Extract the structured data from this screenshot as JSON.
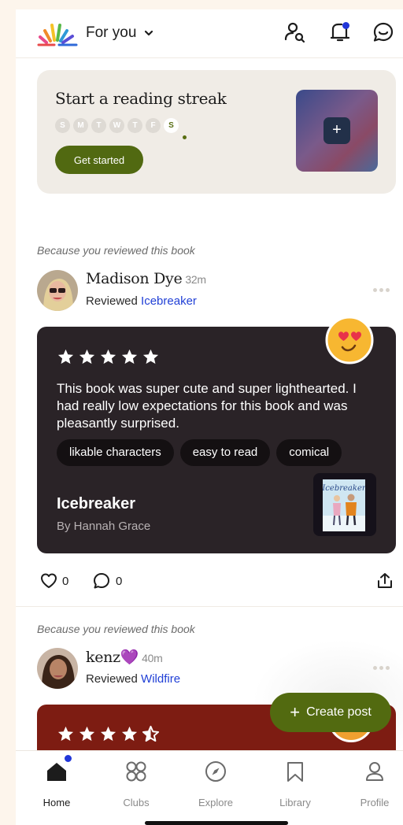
{
  "header": {
    "feed_label": "For you",
    "icons": [
      "rainbow-logo-icon",
      "chevron-down-icon",
      "find-people-icon",
      "notification-icon",
      "messages-icon"
    ]
  },
  "streak": {
    "title": "Start a reading streak",
    "days": [
      "S",
      "M",
      "T",
      "W",
      "T",
      "F",
      "S"
    ],
    "today_index": 6,
    "button": "Get started",
    "add_label": "+"
  },
  "posts": [
    {
      "reason": "Because you reviewed this book",
      "user": "Madison Dye",
      "time": "32m",
      "action": "Reviewed",
      "book": "Icebreaker",
      "rating": 5,
      "review": "This book was super cute and super lighthearted. I had really low expectations for this book and was pleasantly surprised.",
      "tags": [
        "likable characters",
        "easy to read",
        "comical"
      ],
      "book_title": "Icebreaker",
      "book_author": "By Hannah Grace",
      "likes": "0",
      "comments": "0"
    },
    {
      "reason": "Because you reviewed this book",
      "user": "kenz💜",
      "time": "40m",
      "action": "Reviewed",
      "book": "Wildfire",
      "rating": 4.5
    }
  ],
  "fab": {
    "label": "Create post",
    "plus": "+"
  },
  "nav": {
    "items": [
      {
        "label": "Home",
        "icon": "home-icon",
        "active": true
      },
      {
        "label": "Clubs",
        "icon": "clubs-icon"
      },
      {
        "label": "Explore",
        "icon": "compass-icon"
      },
      {
        "label": "Library",
        "icon": "bookmark-icon"
      },
      {
        "label": "Profile",
        "icon": "profile-icon"
      }
    ]
  },
  "colors": {
    "accent_green": "#516911",
    "notification_blue": "#2136d9",
    "link_blue": "#2140d6",
    "review_card_dark": "#2a2327",
    "review_card_red": "#7d1c12"
  }
}
